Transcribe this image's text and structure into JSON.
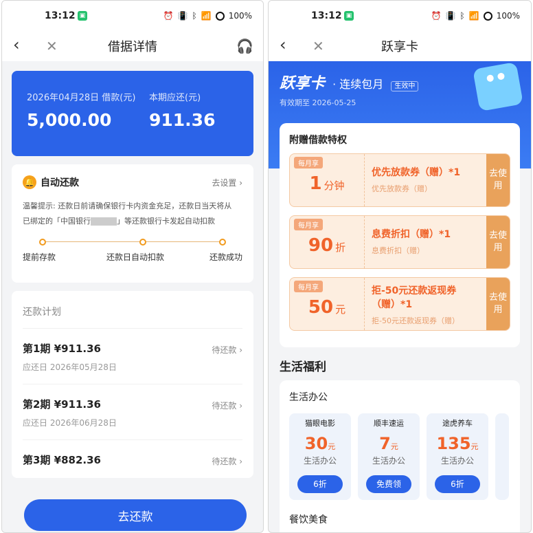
{
  "left": {
    "status": {
      "time": "13:12",
      "battery": "100%"
    },
    "title": "借据详情",
    "loan": {
      "date_label": "2026年04月28日 借款(元)",
      "amount": "5,000.00",
      "due_label": "本期应还(元)",
      "due_amount": "911.36"
    },
    "auto": {
      "title": "自动还款",
      "setting": "去设置",
      "tip_line1": "温馨提示: 还款日前请确保银行卡内资金充足，还款日当天将从",
      "tip_line2_a": "已绑定的「中国银行",
      "tip_line2_b": "」等还款银行卡发起自动扣款",
      "steps": [
        "提前存款",
        "还款日自动扣款",
        "还款成功"
      ]
    },
    "plan": {
      "heading": "还款计划",
      "rows": [
        {
          "period": "第1期 ¥911.36",
          "due": "应还日 2026年05月28日",
          "status": "待还款"
        },
        {
          "period": "第2期 ¥911.36",
          "due": "应还日 2026年06月28日",
          "status": "待还款"
        },
        {
          "period": "第3期 ¥882.36",
          "due": "",
          "status": "待还款"
        }
      ]
    },
    "button": "去还款"
  },
  "right": {
    "status": {
      "time": "13:12",
      "battery": "100%"
    },
    "title": "跃享卡",
    "hero": {
      "name": "跃享卡",
      "sub": "· 连续包月",
      "tag": "生效中",
      "valid": "有效期至 2026-05-25"
    },
    "privilege_title": "附赠借款特权",
    "coupons": [
      {
        "tag": "每月享",
        "num": "1",
        "unit": "分钟",
        "title": "优先放款券（赠）*1",
        "desc": "优先放款券（赠）",
        "action": "去使用"
      },
      {
        "tag": "每月享",
        "num": "90",
        "unit": "折",
        "title": "息费折扣（赠）*1",
        "desc": "息费折扣（赠）",
        "action": "去使用"
      },
      {
        "tag": "每月享",
        "num": "50",
        "unit": "元",
        "title": "拒-50元还款返现券（赠）*1",
        "desc": "拒-50元还款返现券（赠）",
        "action": "去使用"
      }
    ],
    "life_title": "生活福利",
    "category": "生活办公",
    "tiles": [
      {
        "brand": "猫眼电影",
        "num": "30",
        "unit": "元",
        "sub": "生活办公",
        "btn": "6折"
      },
      {
        "brand": "顺丰速运",
        "num": "7",
        "unit": "元",
        "sub": "生活办公",
        "btn": "免费领"
      },
      {
        "brand": "途虎养车",
        "num": "135",
        "unit": "元",
        "sub": "生活办公",
        "btn": "6折"
      }
    ],
    "category2": "餐饮美食"
  }
}
